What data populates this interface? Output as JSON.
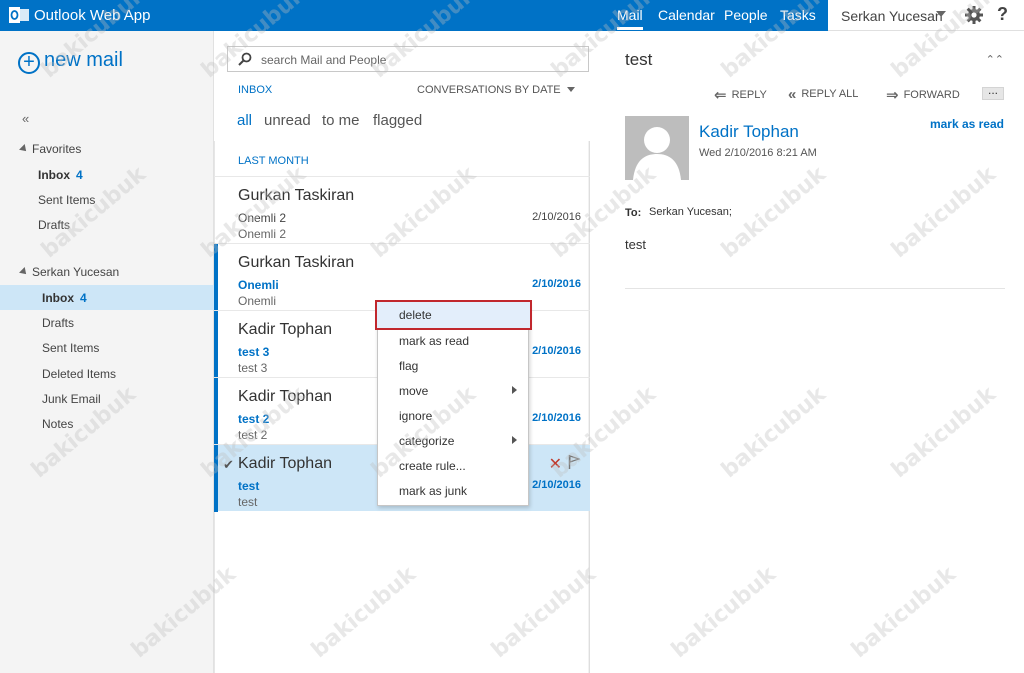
{
  "app": {
    "title": "Outlook Web App"
  },
  "nav": {
    "mail": "Mail",
    "calendar": "Calendar",
    "people": "People",
    "tasks": "Tasks"
  },
  "user": {
    "name": "Serkan Yucesan",
    "help": "?"
  },
  "left": {
    "new_mail": "new mail",
    "collapse": "«",
    "favorites": "Favorites",
    "fav_inbox": "Inbox",
    "fav_inbox_count": "4",
    "fav_sent": "Sent Items",
    "fav_drafts": "Drafts",
    "account": "Serkan Yucesan",
    "inbox": "Inbox",
    "inbox_count": "4",
    "drafts": "Drafts",
    "sent": "Sent Items",
    "deleted": "Deleted Items",
    "junk": "Junk Email",
    "notes": "Notes"
  },
  "mid": {
    "search_placeholder": "search Mail and People",
    "folder_label": "INBOX",
    "sort_label": "CONVERSATIONS BY DATE",
    "filters": {
      "all": "all",
      "unread": "unread",
      "to_me": "to me",
      "flagged": "flagged"
    },
    "group_label": "LAST MONTH",
    "messages": [
      {
        "sender": "Gurkan Taskiran",
        "subject": "Onemli 2",
        "preview": "Onemli 2",
        "date": "2/10/2016"
      },
      {
        "sender": "Gurkan Taskiran",
        "subject": "Onemli",
        "preview": "Onemli",
        "date": "2/10/2016"
      },
      {
        "sender": "Kadir Tophan",
        "subject": "test 3",
        "preview": "test 3",
        "date": "2/10/2016"
      },
      {
        "sender": "Kadir Tophan",
        "subject": "test 2",
        "preview": "test 2",
        "date": "2/10/2016"
      },
      {
        "sender": "Kadir Tophan",
        "subject": "test",
        "preview": "test",
        "date": "2/10/2016"
      }
    ]
  },
  "context_menu": {
    "delete": "delete",
    "mark_read": "mark as read",
    "flag": "flag",
    "move": "move",
    "ignore": "ignore",
    "categorize": "categorize",
    "create_rule": "create rule...",
    "mark_junk": "mark as junk"
  },
  "reading": {
    "subject": "test",
    "expand": "⌃⌃",
    "reply": "REPLY",
    "reply_all": "REPLY ALL",
    "forward": "FORWARD",
    "more": "...",
    "sender": "Kadir Tophan",
    "date": "Wed 2/10/2016 8:21 AM",
    "mark_read": "mark as read",
    "to_label": "To:",
    "to": "Serkan Yucesan;",
    "body": "test"
  },
  "watermark": "bakicubuk",
  "colors": {
    "brand": "#0072c6",
    "selected": "#cde6f7",
    "menu_highlight_border": "#c1272d"
  }
}
